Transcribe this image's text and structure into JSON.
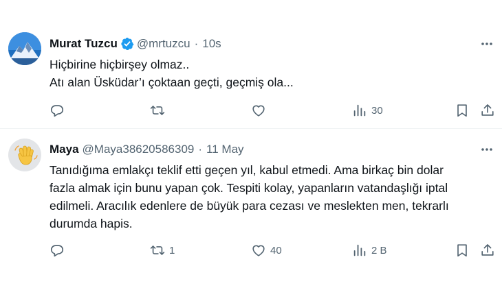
{
  "tweets": [
    {
      "author": "Murat Tuzcu",
      "handle": "@mrtuzcu",
      "separator": "·",
      "time": "10s",
      "lines": [
        "Hiçbirine hiçbirşey olmaz..",
        "Atı alan Üsküdar’ı çoktaan geçti, geçmiş ola..."
      ],
      "verified": true,
      "counts": {
        "replies": "",
        "reposts": "",
        "likes": "",
        "views": "30"
      }
    },
    {
      "author": "Maya",
      "handle": "@Maya38620586309",
      "separator": "·",
      "time": "11 May",
      "lines": [
        "Tanıdığıma emlakçı teklif etti geçen yıl, kabul etmedi.  Ama birkaç bin dolar",
        "fazla almak için bunu yapan çok.  Tespiti kolay,  yapanların vatandaşlığı iptal",
        "edilmeli.  Aracılık edenlere de büyük para cezası ve meslekten men, tekrarlı",
        "durumda hapis."
      ],
      "verified": false,
      "counts": {
        "replies": "",
        "reposts": "1",
        "likes": "40",
        "views": "2 B"
      }
    }
  ],
  "colors": {
    "text": "#0f1419",
    "secondary": "#536471",
    "verified": "#1d9bf0",
    "divider": "#eff3f4"
  },
  "icons": [
    "reply-icon",
    "repost-icon",
    "like-icon",
    "views-icon",
    "bookmark-icon",
    "share-icon",
    "more-icon",
    "verified-badge-icon"
  ]
}
